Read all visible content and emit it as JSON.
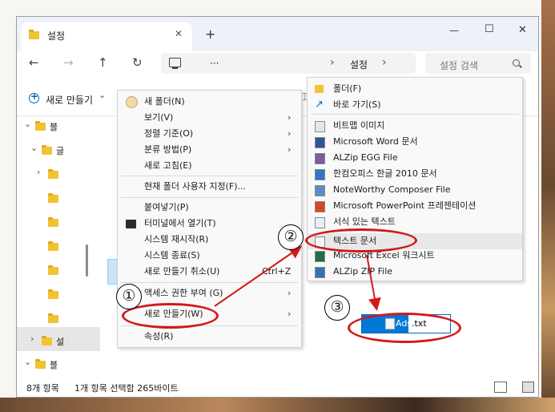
{
  "window": {
    "tab_title": "설정",
    "tab_close": "✕",
    "new_tab": "+",
    "minimize": "—",
    "maximize": "☐",
    "close": "✕"
  },
  "nav": {
    "back": "←",
    "forward": "→",
    "up": "↑",
    "refresh": "↻",
    "ellipsis": "···",
    "chevron": "›",
    "crumb": "설정",
    "crumb_chevron": "›",
    "search_placeholder": "설정 검색"
  },
  "toolbar": {
    "new_button": "새로 만들기",
    "new_chevron": "⌄"
  },
  "sidebar": {
    "items": [
      {
        "label": "블",
        "expander": "⌄"
      },
      {
        "label": "글",
        "expander": "⌄"
      },
      {
        "label": "",
        "expander": "›"
      },
      {
        "label": "",
        "expander": ""
      },
      {
        "label": "",
        "expander": ""
      },
      {
        "label": "",
        "expander": ""
      },
      {
        "label": "",
        "expander": ""
      },
      {
        "label": "",
        "expander": ""
      },
      {
        "label": "",
        "expander": ""
      },
      {
        "label": "설",
        "expander": "›"
      },
      {
        "label": "블",
        "expander": "⌄"
      },
      {
        "label": "",
        "expander": ""
      }
    ]
  },
  "context_menu": {
    "items": [
      {
        "label": "새 폴더(N)",
        "submenu": ""
      },
      {
        "label": "보기(V)",
        "submenu": "›"
      },
      {
        "label": "정렬 기준(O)",
        "submenu": "›"
      },
      {
        "label": "분류 방법(P)",
        "submenu": "›"
      },
      {
        "label": "새로 고침(E)",
        "submenu": ""
      },
      {
        "label": "현재 폴더 사용자 지정(F)...",
        "submenu": ""
      },
      {
        "label": "붙여넣기(P)",
        "submenu": ""
      },
      {
        "label": "터미널에서 열기(T)",
        "submenu": ""
      },
      {
        "label": "시스템 재시작(R)",
        "submenu": ""
      },
      {
        "label": "시스템 종료(S)",
        "submenu": ""
      },
      {
        "label": "새로 만들기 취소(U)",
        "submenu": "",
        "shortcut": "Ctrl+Z"
      },
      {
        "label": "액세스 권한 부여 (G)",
        "submenu": "›"
      },
      {
        "label": "새로 만들기(W)",
        "submenu": "›"
      },
      {
        "label": "속성(R)",
        "submenu": ""
      }
    ]
  },
  "submenu": {
    "items": [
      {
        "label": "폴더(F)",
        "icon": "folder-icon"
      },
      {
        "label": "바로 가기(S)",
        "icon": "shortcut-icon"
      },
      {
        "label": "비트맵 이미지",
        "icon": "bitmap-icon"
      },
      {
        "label": "Microsoft Word 문서",
        "icon": "word-icon"
      },
      {
        "label": "ALZip EGG File",
        "icon": "egg-icon"
      },
      {
        "label": "한컴오피스 한글 2010 문서",
        "icon": "hwp-icon"
      },
      {
        "label": "NoteWorthy Composer File",
        "icon": "nwc-icon"
      },
      {
        "label": "Microsoft PowerPoint 프레젠테이션",
        "icon": "ppt-icon"
      },
      {
        "label": "서식 있는 텍스트",
        "icon": "rtf-icon"
      },
      {
        "label": "텍스트 문서",
        "icon": "txt-icon"
      },
      {
        "label": "Microsoft Excel 워크시트",
        "icon": "excel-icon"
      },
      {
        "label": "ALZip ZIP File",
        "icon": "zip-icon"
      }
    ]
  },
  "rename": {
    "selected_text": "Ads",
    "rest_text": ".txt"
  },
  "annotations": {
    "step1": "①",
    "step2": "②",
    "step3": "③",
    "color": "#d11a1a"
  },
  "status": {
    "count": "8개 항목",
    "selection": "1개 항목 선택함 265바이트"
  }
}
